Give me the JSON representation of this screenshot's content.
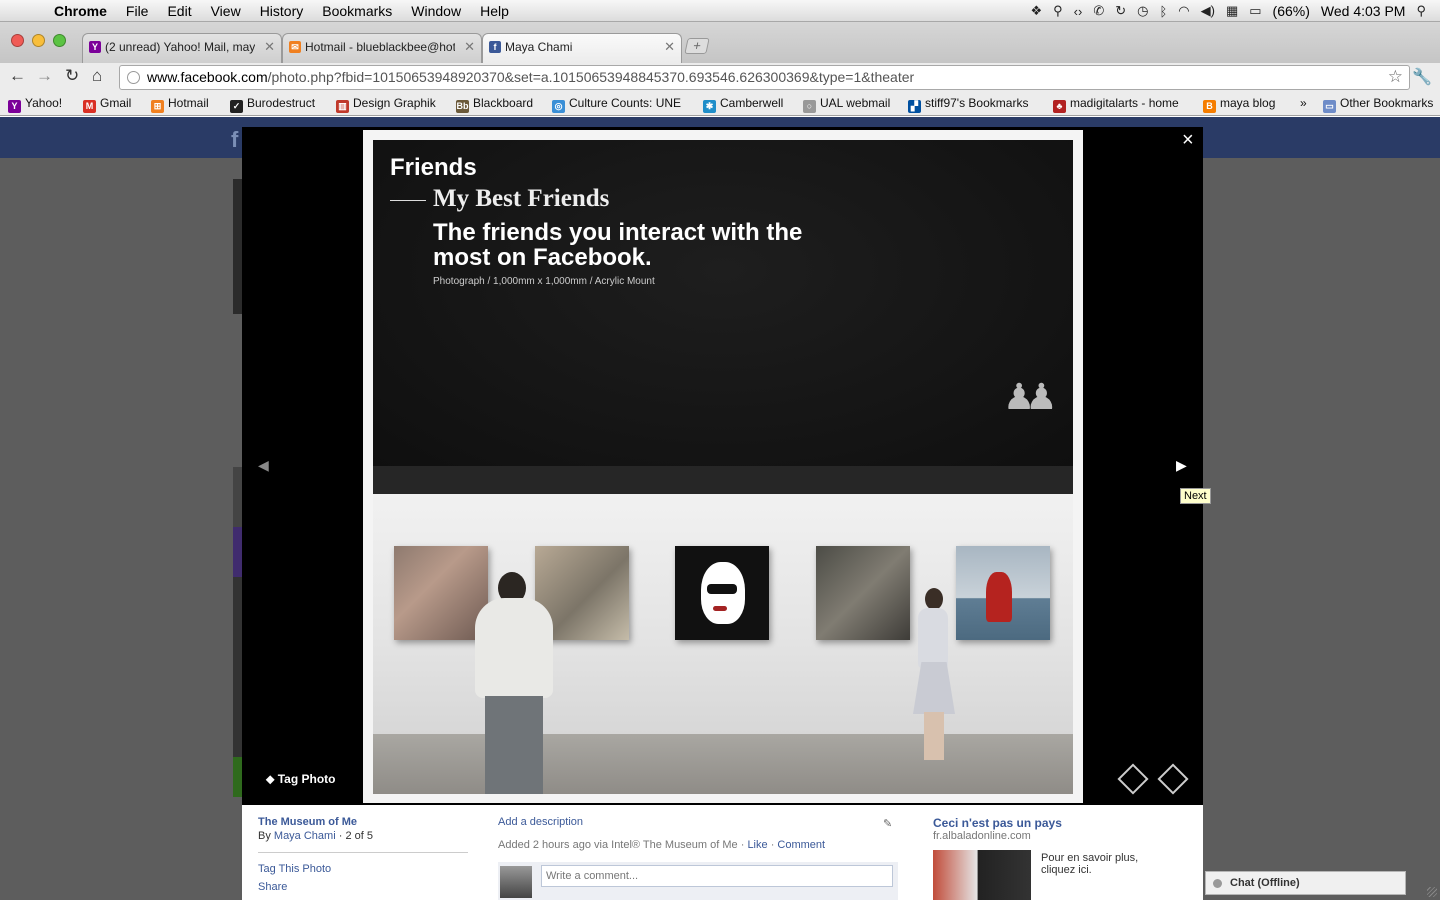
{
  "menubar": {
    "app": "Chrome",
    "menus": [
      "File",
      "Edit",
      "View",
      "History",
      "Bookmarks",
      "Window",
      "Help"
    ],
    "battery": "(66%)",
    "clock": "Wed 4:03 PM"
  },
  "tabs": [
    {
      "label": "(2 unread) Yahoo! Mail, maya",
      "favicon": "yahoo-icon",
      "color": "#7b0099"
    },
    {
      "label": "Hotmail - blueblackbee@hot",
      "favicon": "hotmail-icon",
      "color": "#f08020"
    },
    {
      "label": "Maya Chami",
      "favicon": "facebook-icon",
      "color": "#3b5998"
    }
  ],
  "address": {
    "host": "www.facebook.com",
    "path": "/photo.php?fbid=10150653948920370&set=a.10150653948845370.693546.626300369&type=1&theater"
  },
  "bookmarks": [
    {
      "label": "Yahoo!",
      "color": "#7b0099"
    },
    {
      "label": "Gmail",
      "color": "#d93025"
    },
    {
      "label": "Hotmail",
      "color": "#f08020"
    },
    {
      "label": "Burodestruct",
      "color": "#222222"
    },
    {
      "label": "Design Graphik",
      "color": "#c0392b"
    },
    {
      "label": "Blackboard",
      "color": "#6b5a3a"
    },
    {
      "label": "Culture Counts: UNE",
      "color": "#3a8fd6"
    },
    {
      "label": "Camberwell",
      "color": "#1f8ec9"
    },
    {
      "label": "UAL webmail",
      "color": "#999999"
    },
    {
      "label": "stiff97's Bookmarks",
      "color": "#0050a0"
    },
    {
      "label": "madigitalarts - home",
      "color": "#b22222"
    },
    {
      "label": "maya blog",
      "color": "#f57d00"
    },
    {
      "label": "»",
      "color": ""
    },
    {
      "label": "Other Bookmarks",
      "color": "#6e8cc8"
    }
  ],
  "photo": {
    "title": "Friends",
    "subtitle": "My Best Friends",
    "headline": "The friends you interact with the most on Facebook.",
    "meta": "Photograph / 1,000mm x 1,000mm / Acrylic Mount"
  },
  "theater": {
    "close": "×",
    "prev": "◀",
    "next": "▶",
    "tag_photo": "Tag Photo",
    "next_tooltip": "Next"
  },
  "info": {
    "album": "The Museum of Me",
    "by": "By",
    "author": "Maya Chami",
    "position": "· 2 of 5",
    "tag_link": "Tag This Photo",
    "share_link": "Share",
    "add_description": "Add a description",
    "added": "Added 2 hours ago via Intel® The Museum of Me ·",
    "like": "Like",
    "comment": "Comment",
    "comment_placeholder": "Write a comment...",
    "ad_title": "Ceci n'est pas un pays",
    "ad_domain": "fr.albaladonline.com",
    "ad_text": "Pour en savoir plus, cliquez ici."
  },
  "chat": {
    "label": "Chat (Offline)"
  }
}
